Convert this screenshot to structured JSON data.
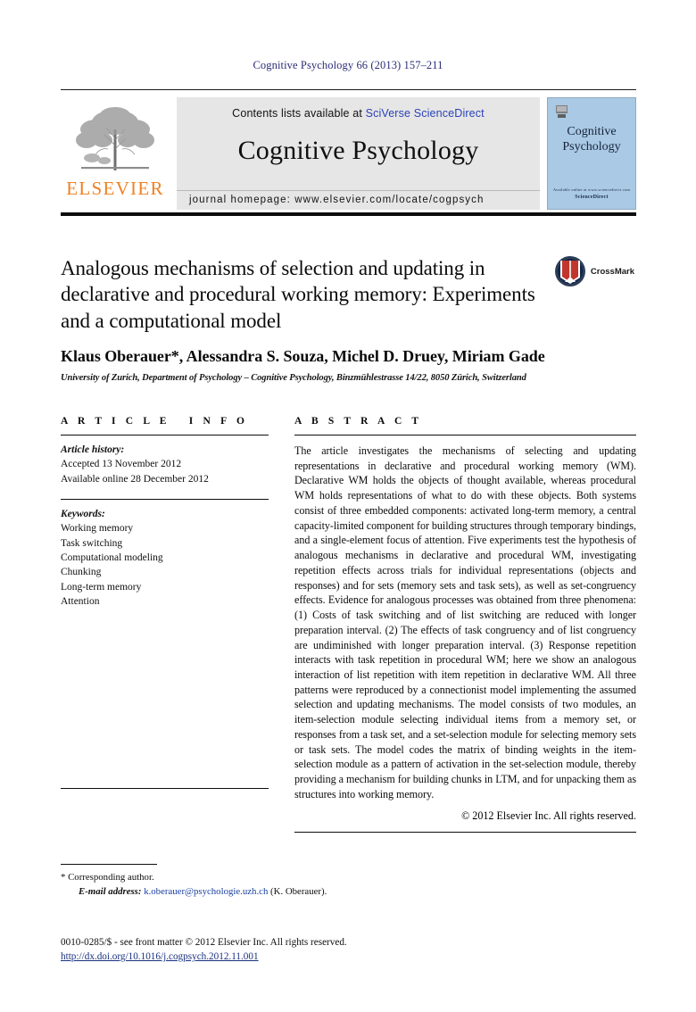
{
  "running_head": "Cognitive Psychology 66 (2013) 157–211",
  "masthead": {
    "publisher_name": "ELSEVIER",
    "contents_prefix": "Contents lists available at ",
    "contents_sciverse": "SciVerse",
    "contents_sciencedirect": " ScienceDirect",
    "journal_name": "Cognitive Psychology",
    "homepage": "journal homepage: www.elsevier.com/locate/cogpsych",
    "cover_title_line1": "Cognitive",
    "cover_title_line2": "Psychology",
    "cover_footer_line1": "Available online at www.sciencedirect.com",
    "cover_footer_line2": "ScienceDirect",
    "accent_orange": "#f08121",
    "link_blue": "#2b42b8",
    "cover_blue": "#a9c9e4",
    "box_gray": "#e6e6e6"
  },
  "article": {
    "title": "Analogous mechanisms of selection and updating in declarative and procedural working memory: Experiments and a computational model",
    "authors": "Klaus Oberauer*, Alessandra S. Souza, Michel D. Druey, Miriam Gade",
    "affiliation": "University of Zurich, Department of Psychology – Cognitive Psychology, Binzmühlestrasse 14/22, 8050 Zürich, Switzerland",
    "crossmark_label": "CrossMark"
  },
  "info": {
    "heading": "A R T I C L E   I N F O",
    "history_label": "Article history:",
    "history_items": [
      "Accepted 13 November 2012",
      "Available online 28 December 2012"
    ],
    "keywords_label": "Keywords:",
    "keywords": [
      "Working memory",
      "Task switching",
      "Computational modeling",
      "Chunking",
      "Long-term memory",
      "Attention"
    ]
  },
  "abstract": {
    "heading": "A B S T R A C T",
    "text": "The article investigates the mechanisms of selecting and updating representations in declarative and procedural working memory (WM). Declarative WM holds the objects of thought available, whereas procedural WM holds representations of what to do with these objects. Both systems consist of three embedded components: activated long-term memory, a central capacity-limited component for building structures through temporary bindings, and a single-element focus of attention. Five experiments test the hypothesis of analogous mechanisms in declarative and procedural WM, investigating repetition effects across trials for individual representations (objects and responses) and for sets (memory sets and task sets), as well as set-congruency effects. Evidence for analogous processes was obtained from three phenomena: (1) Costs of task switching and of list switching are reduced with longer preparation interval. (2) The effects of task congruency and of list congruency are undiminished with longer preparation interval. (3) Response repetition interacts with task repetition in procedural WM; here we show an analogous interaction of list repetition with item repetition in declarative WM. All three patterns were reproduced by a connectionist model implementing the assumed selection and updating mechanisms. The model consists of two modules, an item-selection module selecting individual items from a memory set, or responses from a task set, and a set-selection module for selecting memory sets or task sets. The model codes the matrix of binding weights in the item-selection module as a pattern of activation in the set-selection module, thereby providing a mechanism for building chunks in LTM, and for unpacking them as structures into working memory.",
    "copyright": "© 2012 Elsevier Inc. All rights reserved."
  },
  "footer": {
    "corresponding_author": "* Corresponding author.",
    "email_label": "E-mail address:",
    "email": "k.oberauer@psychologie.uzh.ch",
    "email_suffix": " (K. Oberauer).",
    "colophon": "0010-0285/$ - see front matter © 2012 Elsevier Inc. All rights reserved.",
    "doi": "http://dx.doi.org/10.1016/j.cogpsych.2012.11.001"
  }
}
